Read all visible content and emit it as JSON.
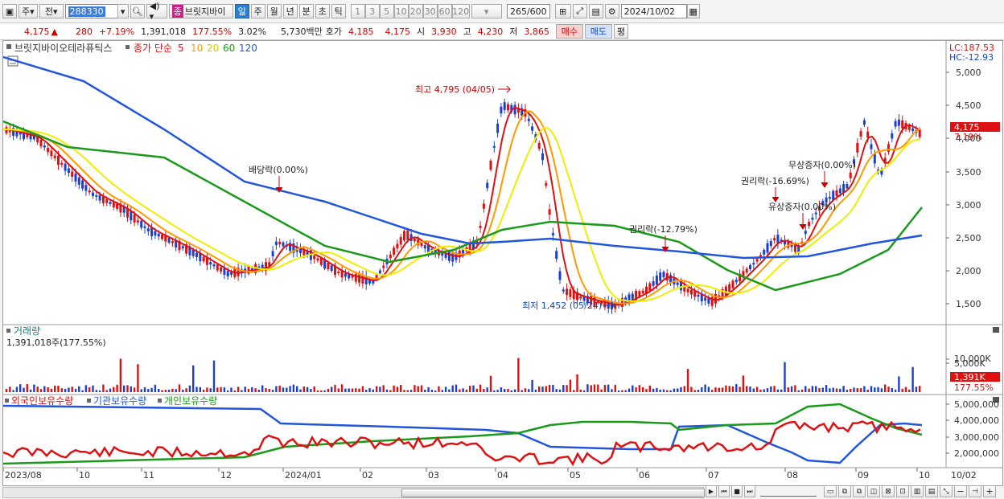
{
  "toolbar": {
    "market": "주",
    "prev": "전",
    "code": "288330",
    "stock_badge": "종",
    "stock_name": "브릿지바이",
    "periods": [
      "일",
      "주",
      "월",
      "년",
      "분",
      "초",
      "틱"
    ],
    "active_period": "일",
    "intervals": [
      "1",
      "3",
      "5",
      "10",
      "20",
      "30",
      "60",
      "120"
    ],
    "count": "265",
    "count_total": "/600",
    "date": "2024/10/02"
  },
  "quote": {
    "price": "4,175",
    "change": "280",
    "rate": "+7.19%",
    "volume": "1,391,018",
    "vol_ratio": "177.55%",
    "turnover": "3.02%",
    "amount": "5,730백만",
    "ask_label": "호가",
    "ask1": "4,185",
    "ask2": "4,175",
    "open_label": "시",
    "open": "3,930",
    "high_label": "고",
    "high": "4,230",
    "low_label": "저",
    "low": "3,865",
    "buy": "매수",
    "sell": "매도",
    "eval": "평"
  },
  "legend": {
    "stock_name": "브릿지바이오테라퓨틱스",
    "ma_title": "종가 단순",
    "ma_periods": [
      "5",
      "10",
      "20",
      "60",
      "120"
    ],
    "ma_colors": [
      "#dd1111",
      "#ff9900",
      "#dddd00",
      "#1a9a1a",
      "#2255dd"
    ]
  },
  "price_axis": {
    "labels": [
      "5,000",
      "4,500",
      "4,000",
      "3,500",
      "3,000",
      "2,500",
      "2,000",
      "1,500"
    ],
    "lc": "LC:187.53",
    "hc": "HC:-12.93",
    "current": "4,175",
    "current_rate": "7.19%"
  },
  "annotations": {
    "high": "최고 4,795 (04/05)",
    "low": "최저 1,452 (05/24)",
    "dividend": "배당락(0.00%)",
    "rights1": "권리락(-12.79%)",
    "rights2": "권리락(-16.69%)",
    "paid_increase": "유상증자(0.00%)",
    "bonus_issue": "무상증자(0.00%)"
  },
  "volume_panel": {
    "title": "거래량",
    "value": "1,391,018주(177.55%)",
    "axis": [
      "10,000K",
      "5,000K"
    ],
    "current": "1,391K",
    "current_rate": "177.55%"
  },
  "holdings_panel": {
    "items": [
      "외국인보유수량",
      "기관보유수량",
      "개인보유수량"
    ],
    "axis": [
      "5,000,000",
      "4,000,000",
      "3,000,000",
      "2,000,000"
    ]
  },
  "date_axis": [
    "2023/08",
    "10",
    "11",
    "12",
    "2024/01",
    "02",
    "03",
    "04",
    "05",
    "06",
    "07",
    "08",
    "09",
    "10",
    "10/02"
  ]
}
